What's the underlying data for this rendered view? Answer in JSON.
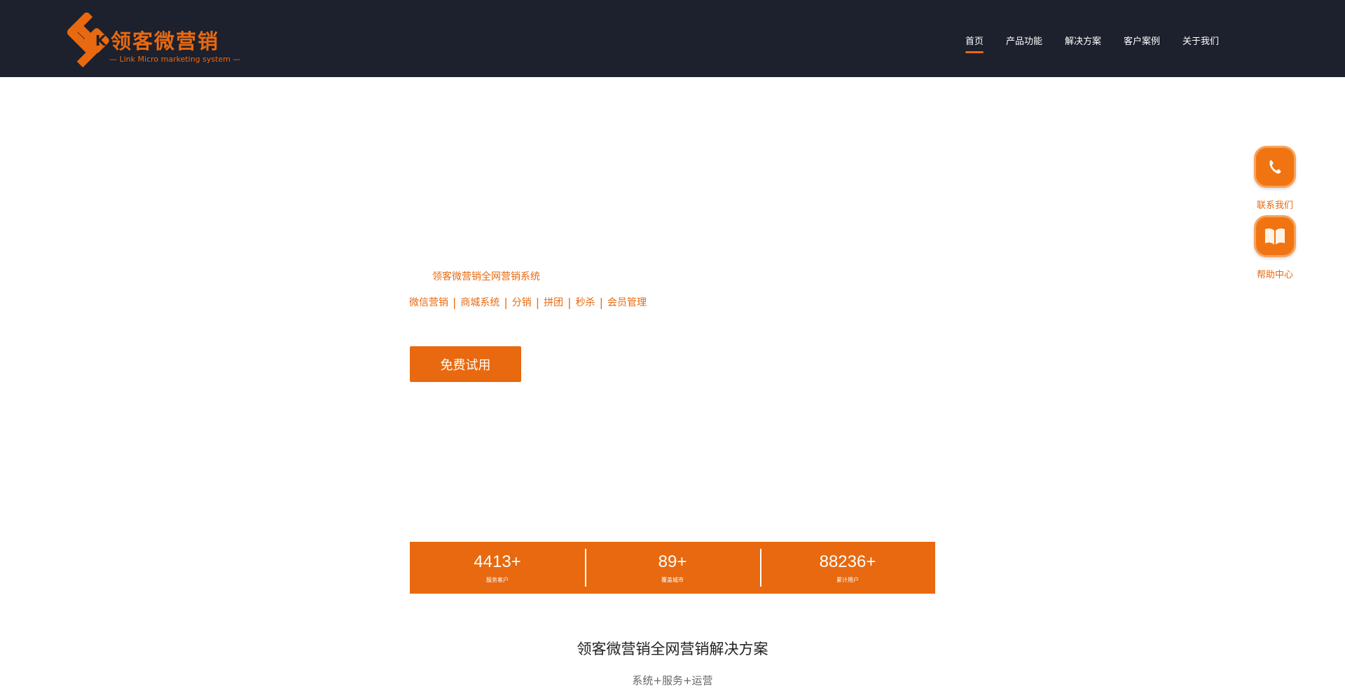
{
  "brand": {
    "name": "领客微营销",
    "tagline": "— Link Micro marketing system —",
    "color": "#e8690f"
  },
  "nav": {
    "items": [
      {
        "label": "首页",
        "active": true
      },
      {
        "label": "产品功能",
        "active": false
      },
      {
        "label": "解决方案",
        "active": false
      },
      {
        "label": "客户案例",
        "active": false
      },
      {
        "label": "关于我们",
        "active": false
      }
    ]
  },
  "side": {
    "phone_label": "联系我们",
    "phone_icon": "phone-icon",
    "book_label": "帮助中心",
    "book_icon": "book-icon"
  },
  "hero": {
    "tagline": "领客微营销全网营销系统",
    "tags": [
      "微信营销",
      "商城系统",
      "分销",
      "拼团",
      "秒杀",
      "会员管理"
    ],
    "cta_label": "免费试用"
  },
  "stats": [
    {
      "value": "4413+",
      "label": "服务客户"
    },
    {
      "value": "89+",
      "label": "覆盖城市"
    },
    {
      "value": "88236+",
      "label": "累计用户"
    }
  ],
  "section": {
    "title": "领客微营销全网营销解决方案",
    "subtitle": "系统+服务+运营"
  }
}
